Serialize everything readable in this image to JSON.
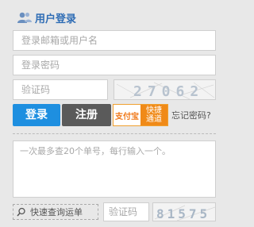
{
  "header": {
    "title": "用户登录",
    "icon": "user-group-icon"
  },
  "login": {
    "username_placeholder": "登录邮箱或用户名",
    "password_placeholder": "登录密码",
    "captcha_placeholder": "验证码",
    "captcha_text": "27062",
    "login_label": "登录",
    "register_label": "注册",
    "alipay_logo_text": "支付宝",
    "alipay_quick_line1": "快捷",
    "alipay_quick_line2": "通道",
    "forgot_label": "忘记密码?"
  },
  "tracking": {
    "textarea_placeholder": "一次最多查20个单号，每行输入一个。",
    "quick_query_label": "快速查询运单",
    "captcha_placeholder": "验证码",
    "captcha_text": "81575"
  },
  "colors": {
    "accent": "#2f6db5",
    "login": "#1e8fe0",
    "register": "#5a5a5a",
    "alipay": "#f08a18"
  }
}
